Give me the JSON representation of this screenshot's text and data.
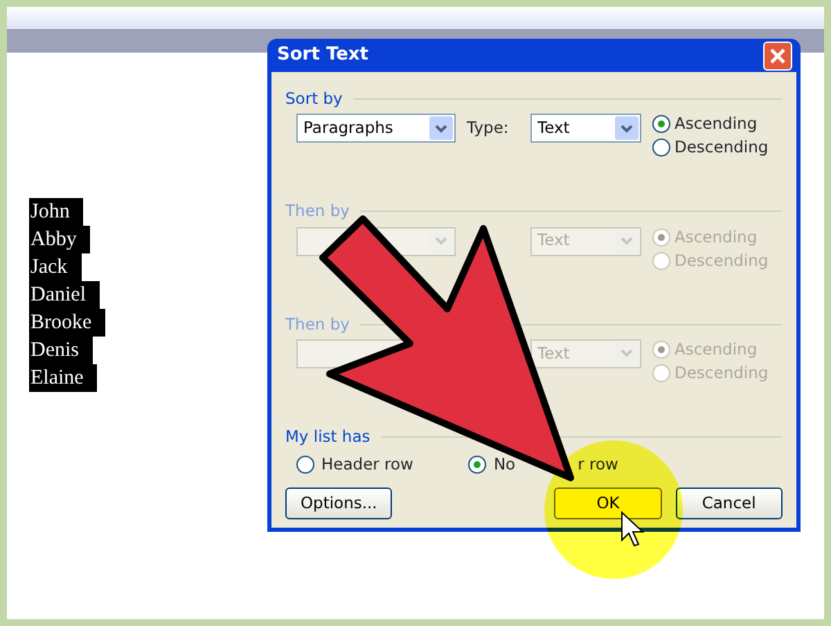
{
  "document": {
    "lines": [
      {
        "text": "John",
        "selected": true
      },
      {
        "text": "Abby",
        "selected": true
      },
      {
        "text": "Jack",
        "selected": true
      },
      {
        "text": "Daniel",
        "selected": true
      },
      {
        "text": "Brooke",
        "selected": true
      },
      {
        "text": "Denis",
        "selected": true
      },
      {
        "text": "Elaine",
        "selected": true
      }
    ]
  },
  "dialog": {
    "title": "Sort Text",
    "sort_groups": [
      {
        "label": "Sort by",
        "disabled": false,
        "field": {
          "value": "Paragraphs"
        },
        "type_label": "Type:",
        "type_field": {
          "value": "Text"
        },
        "radios": [
          {
            "label": "Ascending",
            "selected": true
          },
          {
            "label": "Descending",
            "selected": false
          }
        ]
      },
      {
        "label": "Then by",
        "disabled": true,
        "type_field": {
          "value": "Text"
        },
        "radios": [
          {
            "label": "Ascending",
            "selected": true
          },
          {
            "label": "Descending",
            "selected": false
          }
        ]
      },
      {
        "label": "Then by",
        "disabled": true,
        "type_field": {
          "value": "Text"
        },
        "radios": [
          {
            "label": "Ascending",
            "selected": true
          },
          {
            "label": "Descending",
            "selected": false
          }
        ]
      }
    ],
    "list_has": {
      "label": "My list has",
      "options": [
        {
          "label_parts": [
            "Header row"
          ],
          "selected": false
        },
        {
          "label_parts": [
            "No",
            "r row"
          ],
          "selected": true
        }
      ]
    },
    "buttons": [
      {
        "label": "Options...",
        "kind": "options"
      },
      {
        "label": "OK",
        "kind": "default"
      },
      {
        "label": "Cancel",
        "kind": "normal"
      }
    ]
  }
}
